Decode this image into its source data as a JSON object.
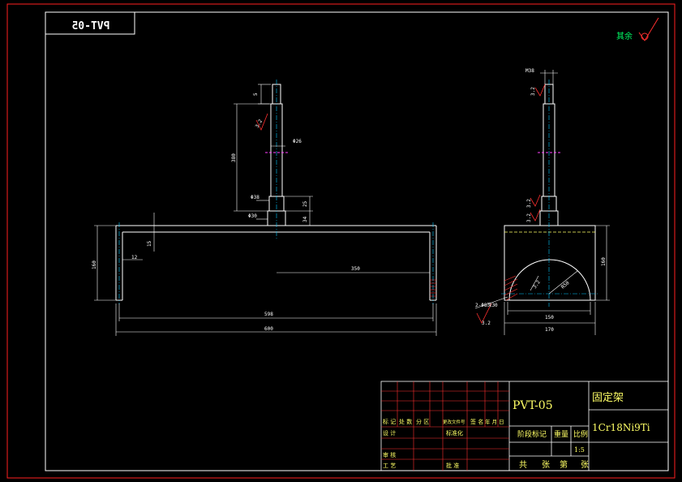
{
  "colors": {
    "background": "#000000",
    "border_outer": "#ff2020",
    "border_inner": "#ffffff",
    "dimension": "#ffffff",
    "centerline": "#00c8ff",
    "roughness": "#ff3030",
    "annotation_green": "#00ff66",
    "section_hatch": "#ff3333",
    "magenta_mark": "#ff40ff",
    "titleblock_text": "#ffff66"
  },
  "code_box": {
    "text": "PVT-05"
  },
  "surface_note": {
    "text": "其余"
  },
  "front_view": {
    "dims": {
      "d_top": "5",
      "d_380": "380",
      "d_od": "Φ26",
      "d_rough_top": "3.2",
      "d_phi38": "Φ38",
      "d_phi30": "Φ30",
      "d_25": "25",
      "d_34": "34",
      "d_15": "15",
      "d_160": "160",
      "d_12": "12",
      "d_350": "350",
      "d_598": "598",
      "d_600": "600"
    }
  },
  "side_view": {
    "dims": {
      "d_m38": "M38",
      "d_rough1": "3.2",
      "d_rough2": "3.2",
      "d_rough3": "3.2",
      "d_r50": "R50",
      "d_rough_r": "3.2",
      "d_hole": "2-Φ8深30",
      "d_rough_hole": "3.2",
      "d_150": "150",
      "d_170": "170",
      "d_160": "160"
    }
  },
  "title_block": {
    "drawing_no": "PVT-05",
    "part_name": "固定架",
    "material": "1Cr18Ni9Ti",
    "scale": "1:5",
    "labels": {
      "mark": "标 记",
      "count": "处 数",
      "zone": "分 区",
      "change_doc": "更改文件号",
      "sign": "签 名",
      "date": "年 月 日",
      "design": "设 计",
      "standardize": "标准化",
      "stage": "阶段标记",
      "weight": "重量",
      "ratio": "比例",
      "review": "审 核",
      "process": "工 艺",
      "approve": "批 准",
      "total": "共",
      "sheets": "张",
      "page": "第",
      "sheet": "张"
    }
  }
}
